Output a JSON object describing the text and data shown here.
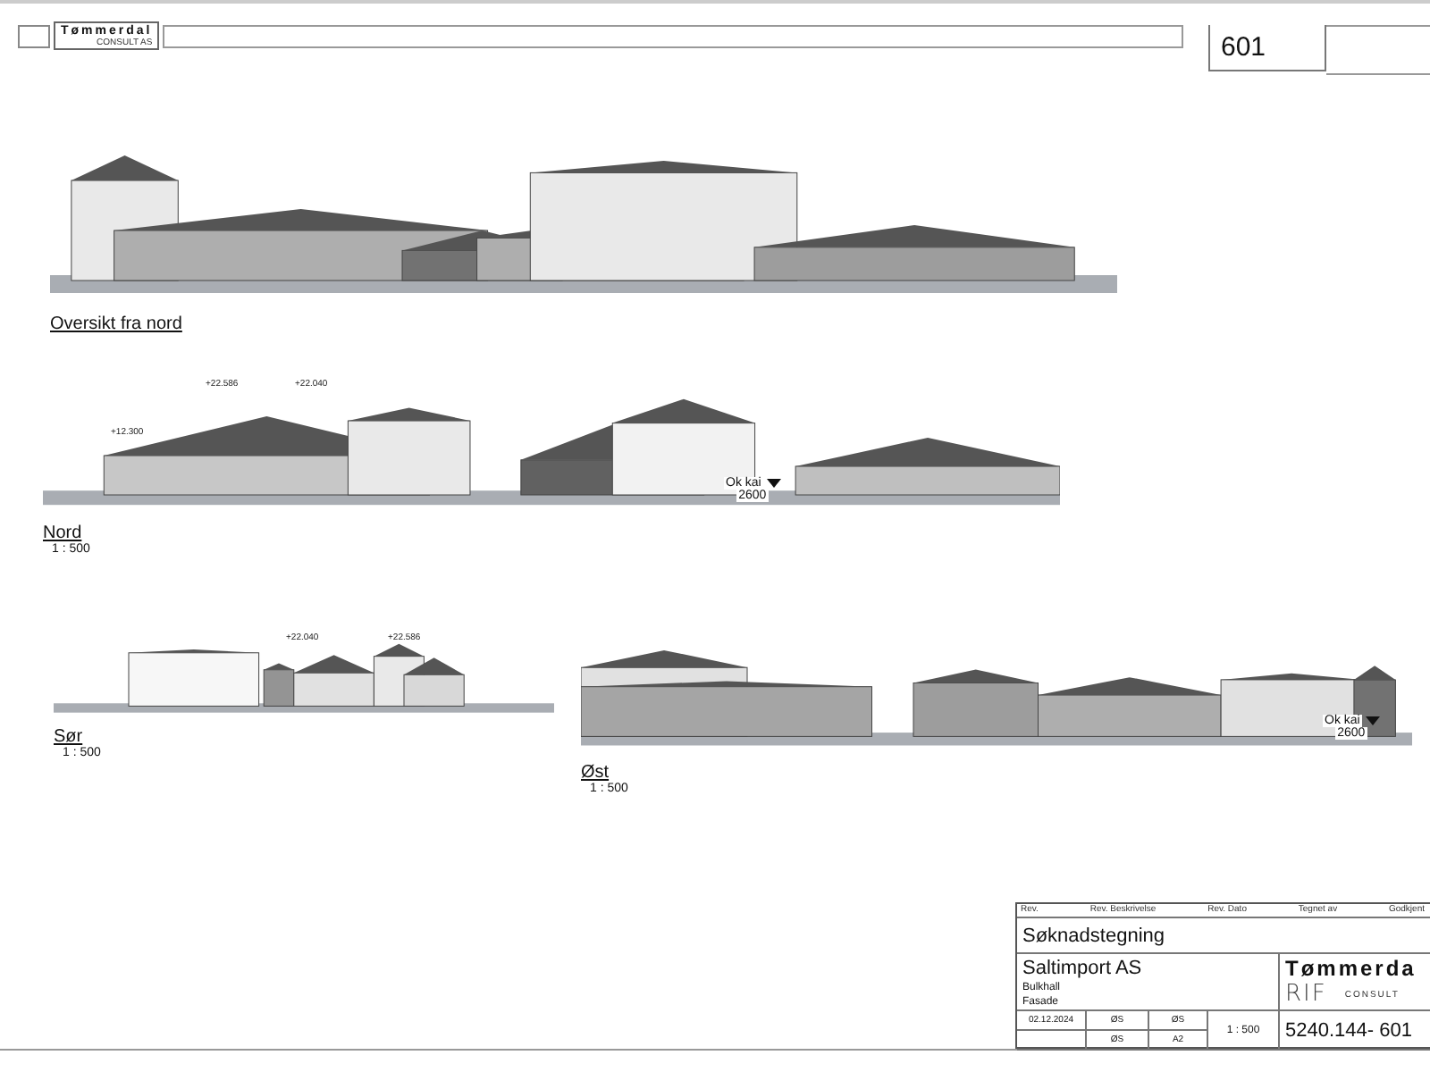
{
  "header": {
    "logo": {
      "name": "Tømmerdal",
      "sub": "CONSULT AS"
    },
    "sheet_number": "601"
  },
  "views": [
    {
      "title": "Oversikt fra nord"
    },
    {
      "title": "Nord",
      "scale": "1 : 500",
      "annotations": [
        {
          "kind": "elevation",
          "text": "+22.586"
        },
        {
          "kind": "elevation",
          "text": "+22.040"
        },
        {
          "kind": "elevation",
          "text": "+12.300"
        },
        {
          "kind": "level",
          "text": "Ok kai",
          "value": "2600"
        }
      ]
    },
    {
      "title": "Sør",
      "scale": "1 : 500",
      "annotations": [
        {
          "kind": "elevation",
          "text": "+22.040"
        },
        {
          "kind": "elevation",
          "text": "+22.586"
        }
      ]
    },
    {
      "title": "Øst",
      "scale": "1 : 500",
      "annotations": [
        {
          "kind": "level",
          "text": "Ok kai",
          "value": "2600"
        }
      ]
    }
  ],
  "title_block": {
    "header_labels": [
      "Rev.",
      "Rev. Beskrivelse",
      "Rev. Dato",
      "Tegnet av",
      "Godkjent"
    ],
    "drawing_type": "Søknadstegning",
    "client": "Saltimport AS",
    "project": "Bulkhall",
    "content": "Fasade",
    "logo": {
      "name": "Tømmerda",
      "sub": "CONSULT",
      "badge": "RIF"
    },
    "date": "02.12.2024",
    "designed_by": "ØS",
    "drawn_by": "ØS",
    "checked_by": "ØS",
    "format": "A2",
    "scale": "1 : 500",
    "drawing_number": "5240.144- 601"
  }
}
